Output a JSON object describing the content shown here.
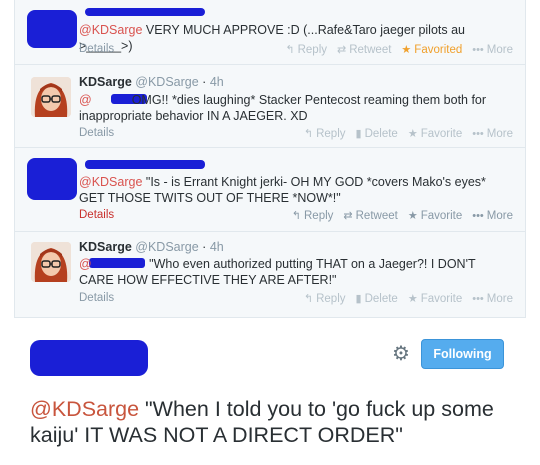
{
  "tweets": [
    {
      "mention": "@KDSarge",
      "text": " VERY MUCH APPROVE :D (...Rafe&Taro jaeger pilots au >_____>)",
      "details": "Details",
      "reply": "Reply",
      "retweet": "Retweet",
      "favorite": "Favorited",
      "more": "More"
    },
    {
      "name": "KDSarge",
      "handle": "@KDSarge",
      "time": "4h",
      "mention": "@",
      "text": "OMG!! *dies laughing* Stacker Pentecost reaming them both for inappropriate behavior IN A JAEGER. XD",
      "details": "Details",
      "reply": "Reply",
      "delete": "Delete",
      "favorite": "Favorite",
      "more": "More"
    },
    {
      "mention": "@KDSarge",
      "text": " \"Is - is Errant Knight jerki- OH MY GOD *covers Mako's eyes* GET THOSE TWITS OUT OF THERE *NOW*!\"",
      "details": "Details",
      "reply": "Reply",
      "retweet": "Retweet",
      "favorite": "Favorite",
      "more": "More"
    },
    {
      "name": "KDSarge",
      "handle": "@KDSarge",
      "time": "4h",
      "mention": "@",
      "text": " \"Who even authorized putting THAT on a Jaeger?! I DON'T CARE HOW EFFECTIVE THEY ARE AFTER!\"",
      "details": "Details",
      "reply": "Reply",
      "delete": "Delete",
      "favorite": "Favorite",
      "more": "More"
    }
  ],
  "main": {
    "follow_label": "Following",
    "mention": "@KDSarge",
    "text": " \"When I told you to 'go fuck up some kaiju' IT WAS NOT A DIRECT ORDER\""
  },
  "icons": {
    "reply": "reply-icon",
    "retweet": "retweet-icon",
    "delete": "trash-icon",
    "favorite": "star-icon",
    "more": "more-dots-icon",
    "gear": "gear-icon"
  },
  "colors": {
    "mention": "#d9534f",
    "favorited": "#f0a02c",
    "follow_button": "#55acee",
    "redaction": "#1a1fd6"
  }
}
